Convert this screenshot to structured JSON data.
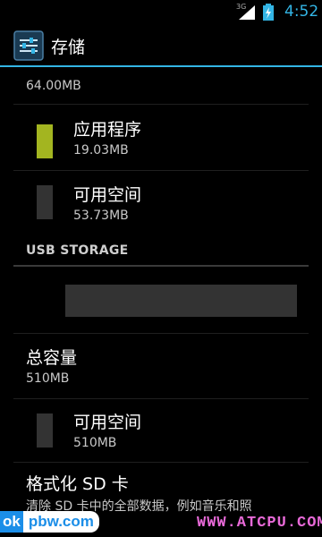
{
  "status_bar": {
    "network": "3G",
    "time": "4:52",
    "accent_color": "#33b5e5"
  },
  "action_bar": {
    "title": "存储",
    "icon": "settings-sliders-icon"
  },
  "top_partial": {
    "value": "64.00MB"
  },
  "internal_items": [
    {
      "label": "应用程序",
      "value": "19.03MB",
      "color": "#a3b520"
    },
    {
      "label": "可用空间",
      "value": "53.73MB",
      "color": "#333333"
    }
  ],
  "usb_section": {
    "header": "USB STORAGE",
    "bar_color": "#333333",
    "total_label": "总容量",
    "total_value": "510MB",
    "available_label": "可用空间",
    "available_value": "510MB",
    "available_color": "#333333",
    "format_label": "格式化 SD 卡",
    "format_desc": "清除 SD 卡中的全部数据，例如音乐和照"
  },
  "watermark": {
    "left_badge": "ok",
    "left_site": "pbw.com",
    "right_site": "WWW.ATCPU.COM"
  }
}
